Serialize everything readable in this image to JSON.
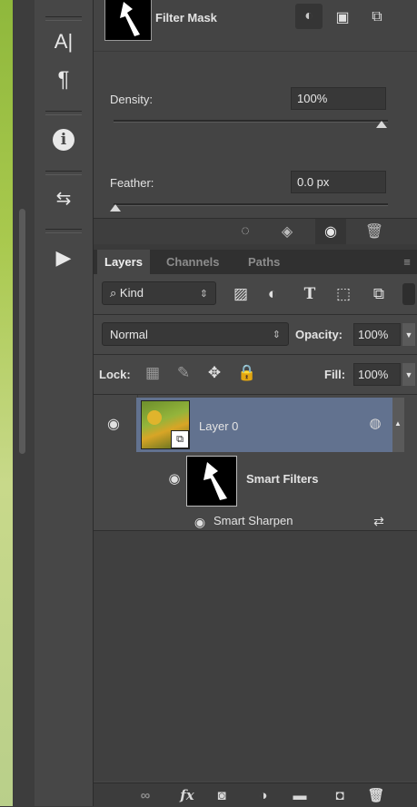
{
  "tool_strip": {
    "buttons": [
      {
        "name": "character-tool",
        "glyph": "A|"
      },
      {
        "name": "paragraph-tool",
        "glyph": "¶"
      },
      {
        "name": "info-tool",
        "glyph": "i"
      },
      {
        "name": "history-tool",
        "glyph": "⇆"
      },
      {
        "name": "actions-tool",
        "glyph": "▶"
      }
    ]
  },
  "properties": {
    "title": "Filter Mask",
    "density_label": "Density:",
    "density_value": "100%",
    "density_fraction": 1.0,
    "feather_label": "Feather:",
    "feather_value": "0.0 px",
    "feather_fraction": 0.0
  },
  "tabs": [
    "Layers",
    "Channels",
    "Paths"
  ],
  "layers": {
    "filter_kind": "Kind",
    "blend_mode": "Normal",
    "opacity_label": "Opacity:",
    "opacity_value": "100%",
    "lock_label": "Lock:",
    "fill_label": "Fill:",
    "fill_value": "100%",
    "layer_name": "Layer 0",
    "smart_filters_label": "Smart Filters",
    "filter_name": "Smart Sharpen"
  },
  "colors": {
    "panel": "#474747",
    "selected_row": "#62728f",
    "accent_green": "#93b43b"
  }
}
